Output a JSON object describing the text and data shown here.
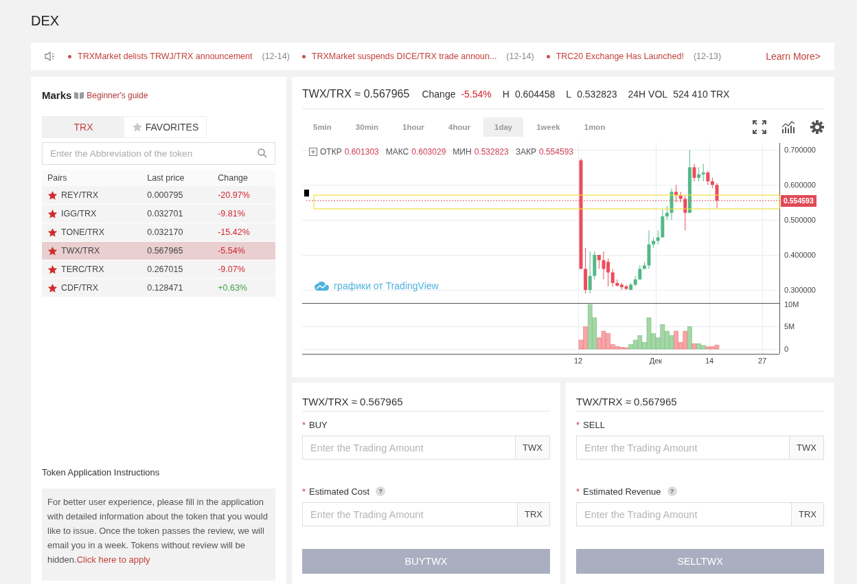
{
  "page_title": "DEX",
  "ticker": {
    "items": [
      {
        "text": "TRXMarket delists TRWJ/TRX announcement",
        "date": "(12-14)"
      },
      {
        "text": "TRXMarket suspends DICE/TRX trade announ...",
        "date": "(12-14)"
      },
      {
        "text": "TRC20 Exchange Has Launched!",
        "date": "(12-13)"
      }
    ],
    "link": "Learn More>"
  },
  "market": {
    "title": "Marks",
    "guide_link": "Beginner's guide",
    "tabs": [
      {
        "label": "TRX",
        "selected": true,
        "kind": "plain"
      },
      {
        "label": "FAVORITES",
        "selected": false,
        "kind": "starred"
      }
    ],
    "search": {
      "placeholder": "Enter the Abbreviation of the token"
    },
    "table": {
      "columns": [
        "Pairs",
        "Last price",
        "Change"
      ],
      "rows": [
        {
          "pair": "REY/TRX",
          "price": "0.000795",
          "change": "-20.97%",
          "color": "#d0262f",
          "favorite": true,
          "selected": false
        },
        {
          "pair": "IGG/TRX",
          "price": "0.032701",
          "change": "-9.81%",
          "color": "#d0262f",
          "favorite": true,
          "selected": false
        },
        {
          "pair": "TONE/TRX",
          "price": "0.032170",
          "change": "-15.42%",
          "color": "#d0262f",
          "favorite": true,
          "selected": false
        },
        {
          "pair": "TWX/TRX",
          "price": "0.567965",
          "change": "-5.54%",
          "color": "#d0262f",
          "favorite": true,
          "selected": true
        },
        {
          "pair": "TERC/TRX",
          "price": "0.267015",
          "change": "-9.07%",
          "color": "#d0262f",
          "favorite": true,
          "selected": false
        },
        {
          "pair": "CDF/TRX",
          "price": "0.128471",
          "change": "+0.63%",
          "color": "#43a047",
          "favorite": true,
          "selected": false
        }
      ]
    }
  },
  "instructions": {
    "title": "Token Application Instructions",
    "text": "For better user experience, please fill in the application with detailed information about the token that you would like to issue. Once the token passes the review, we will email you in a week. Tokens without review will be hidden.",
    "link": "Click here to apply"
  },
  "chart": {
    "pair_price": "TWX/TRX ≈ 0.567965",
    "stats": [
      {
        "label": "Change",
        "value": "-5.54%",
        "kind": "change"
      },
      {
        "label": "H",
        "value": "0.604458",
        "kind": "plain"
      },
      {
        "label": "L",
        "value": "0.532823",
        "kind": "plain"
      },
      {
        "label": "24H VOL",
        "value": "524 410 TRX",
        "kind": "plain"
      }
    ],
    "intervals": [
      {
        "label": "5min",
        "selected": false
      },
      {
        "label": "30min",
        "selected": false
      },
      {
        "label": "1hour",
        "selected": false
      },
      {
        "label": "4hour",
        "selected": false
      },
      {
        "label": "1day",
        "selected": true
      },
      {
        "label": "1week",
        "selected": false
      },
      {
        "label": "1mon",
        "selected": false
      }
    ],
    "legend": [
      {
        "label": "ОТКР",
        "value": "0.601303"
      },
      {
        "label": "МАКС",
        "value": "0.603029"
      },
      {
        "label": "МИН",
        "value": "0.532823"
      },
      {
        "label": "ЗАКР",
        "value": "0.554593"
      }
    ],
    "price_axis": [
      "0.700000",
      "0.600000",
      "0.500000",
      "0.400000",
      "0.300000"
    ],
    "current_price": "0.554593",
    "volume_axis": [
      "10M",
      "5M",
      "0"
    ],
    "time_axis": [
      "12",
      "Дек",
      "14",
      "27"
    ],
    "attribution": "графики от TradingView"
  },
  "trade": [
    {
      "pair_price": "TWX/TRX ≈ 0.567965",
      "fields": [
        {
          "mark": "*",
          "label": "BUY",
          "placeholder": "Enter the Trading Amount",
          "unit": "TWX"
        },
        {
          "mark": "*",
          "label": "Estimated Cost",
          "help": "?",
          "placeholder": "Enter the Trading Amount",
          "unit": "TRX"
        }
      ],
      "button": {
        "label": "BUYTWX",
        "disabled": true
      }
    },
    {
      "pair_price": "TWX/TRX ≈ 0.567965",
      "fields": [
        {
          "mark": "*",
          "label": "SELL",
          "placeholder": "Enter the Trading Amount",
          "unit": "TWX"
        },
        {
          "mark": "*",
          "label": "Estimated Revenue",
          "help": "?",
          "placeholder": "Enter the Trading Amount",
          "unit": "TRX"
        }
      ],
      "button": {
        "label": "SELLTWX",
        "disabled": true
      }
    }
  ]
}
